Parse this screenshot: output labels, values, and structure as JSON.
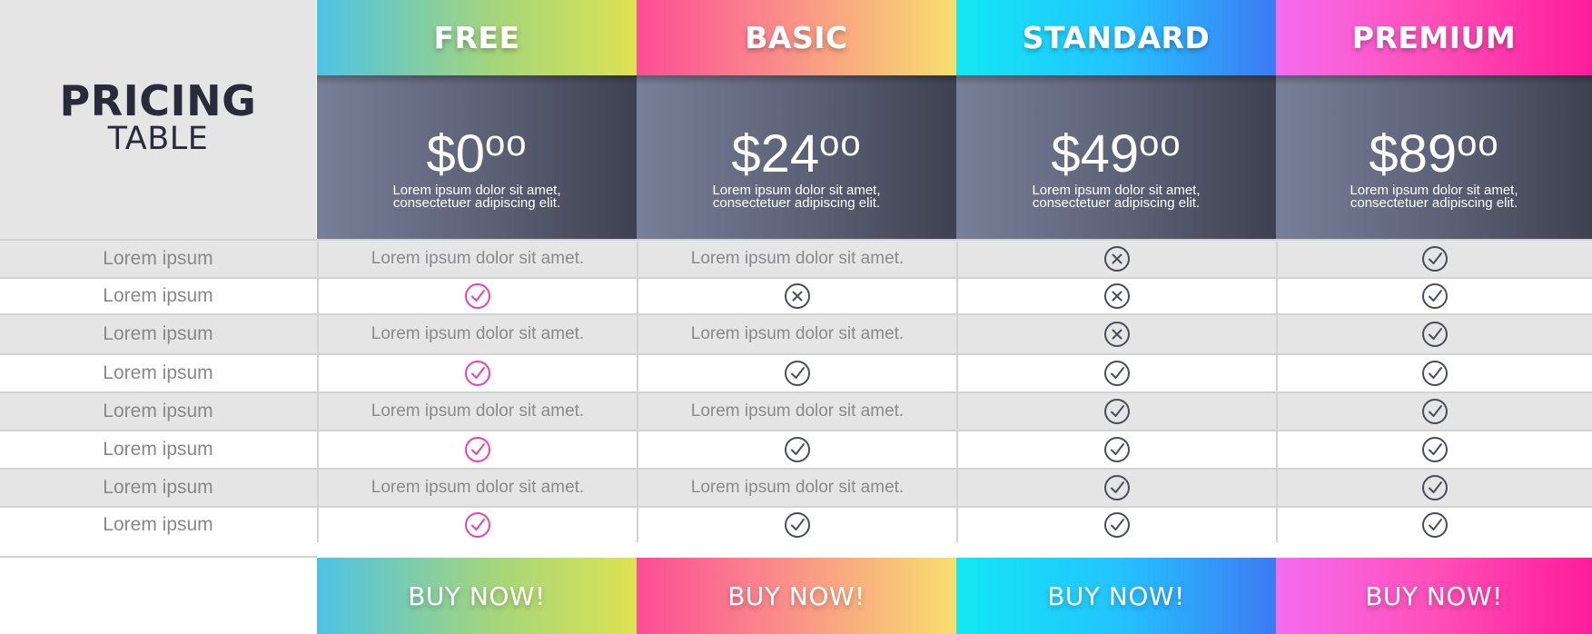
{
  "title": {
    "main": "PRICING",
    "sub": "TABLE"
  },
  "plans": [
    {
      "name": "FREE",
      "price_main": "$0",
      "price_cents": "oo",
      "desc_line1": "Lorem ipsum dolor sit amet,",
      "desc_line2": "consectetuer adipiscing elit.",
      "buy_label": "BUY NOW!"
    },
    {
      "name": "BASIC",
      "price_main": "$24",
      "price_cents": "oo",
      "desc_line1": "Lorem ipsum dolor sit amet,",
      "desc_line2": "consectetuer adipiscing elit.",
      "buy_label": "BUY NOW!"
    },
    {
      "name": "STANDARD",
      "price_main": "$49",
      "price_cents": "oo",
      "desc_line1": "Lorem ipsum dolor sit amet,",
      "desc_line2": "consectetuer adipiscing elit.",
      "buy_label": "BUY NOW!"
    },
    {
      "name": "PREMIUM",
      "price_main": "$89",
      "price_cents": "oo",
      "desc_line1": "Lorem ipsum dolor sit amet,",
      "desc_line2": "consectetuer adipiscing elit.",
      "buy_label": "BUY NOW!"
    }
  ],
  "colors": {
    "check_free": "#ee3fb0",
    "icon_dark": "#4a4c5a"
  },
  "rows": [
    {
      "label": "Lorem ipsum",
      "cells": [
        {
          "kind": "text",
          "text": "Lorem ipsum dolor sit amet."
        },
        {
          "kind": "text",
          "text": "Lorem ipsum dolor sit amet."
        },
        {
          "kind": "icon",
          "icon": "x-circle-icon"
        },
        {
          "kind": "icon",
          "icon": "check-circle-icon"
        }
      ]
    },
    {
      "label": "Lorem ipsum",
      "cells": [
        {
          "kind": "icon",
          "icon": "check-circle-icon"
        },
        {
          "kind": "icon",
          "icon": "x-circle-icon"
        },
        {
          "kind": "icon",
          "icon": "x-circle-icon"
        },
        {
          "kind": "icon",
          "icon": "check-circle-icon"
        }
      ]
    },
    {
      "label": "Lorem ipsum",
      "cells": [
        {
          "kind": "text",
          "text": "Lorem ipsum dolor sit amet."
        },
        {
          "kind": "text",
          "text": "Lorem ipsum dolor sit amet."
        },
        {
          "kind": "icon",
          "icon": "x-circle-icon"
        },
        {
          "kind": "icon",
          "icon": "check-circle-icon"
        }
      ]
    },
    {
      "label": "Lorem ipsum",
      "cells": [
        {
          "kind": "icon",
          "icon": "check-circle-icon"
        },
        {
          "kind": "icon",
          "icon": "check-circle-icon"
        },
        {
          "kind": "icon",
          "icon": "check-circle-icon"
        },
        {
          "kind": "icon",
          "icon": "check-circle-icon"
        }
      ]
    },
    {
      "label": "Lorem ipsum",
      "cells": [
        {
          "kind": "text",
          "text": "Lorem ipsum dolor sit amet."
        },
        {
          "kind": "text",
          "text": "Lorem ipsum dolor sit amet."
        },
        {
          "kind": "icon",
          "icon": "check-circle-icon"
        },
        {
          "kind": "icon",
          "icon": "check-circle-icon"
        }
      ]
    },
    {
      "label": "Lorem ipsum",
      "cells": [
        {
          "kind": "icon",
          "icon": "check-circle-icon"
        },
        {
          "kind": "icon",
          "icon": "check-circle-icon"
        },
        {
          "kind": "icon",
          "icon": "check-circle-icon"
        },
        {
          "kind": "icon",
          "icon": "check-circle-icon"
        }
      ]
    },
    {
      "label": "Lorem ipsum",
      "cells": [
        {
          "kind": "text",
          "text": "Lorem ipsum dolor sit amet."
        },
        {
          "kind": "text",
          "text": "Lorem ipsum dolor sit amet."
        },
        {
          "kind": "icon",
          "icon": "check-circle-icon"
        },
        {
          "kind": "icon",
          "icon": "check-circle-icon"
        }
      ]
    },
    {
      "label": "Lorem ipsum",
      "cells": [
        {
          "kind": "icon",
          "icon": "check-circle-icon"
        },
        {
          "kind": "icon",
          "icon": "check-circle-icon"
        },
        {
          "kind": "icon",
          "icon": "check-circle-icon"
        },
        {
          "kind": "icon",
          "icon": "check-circle-icon"
        }
      ]
    }
  ]
}
